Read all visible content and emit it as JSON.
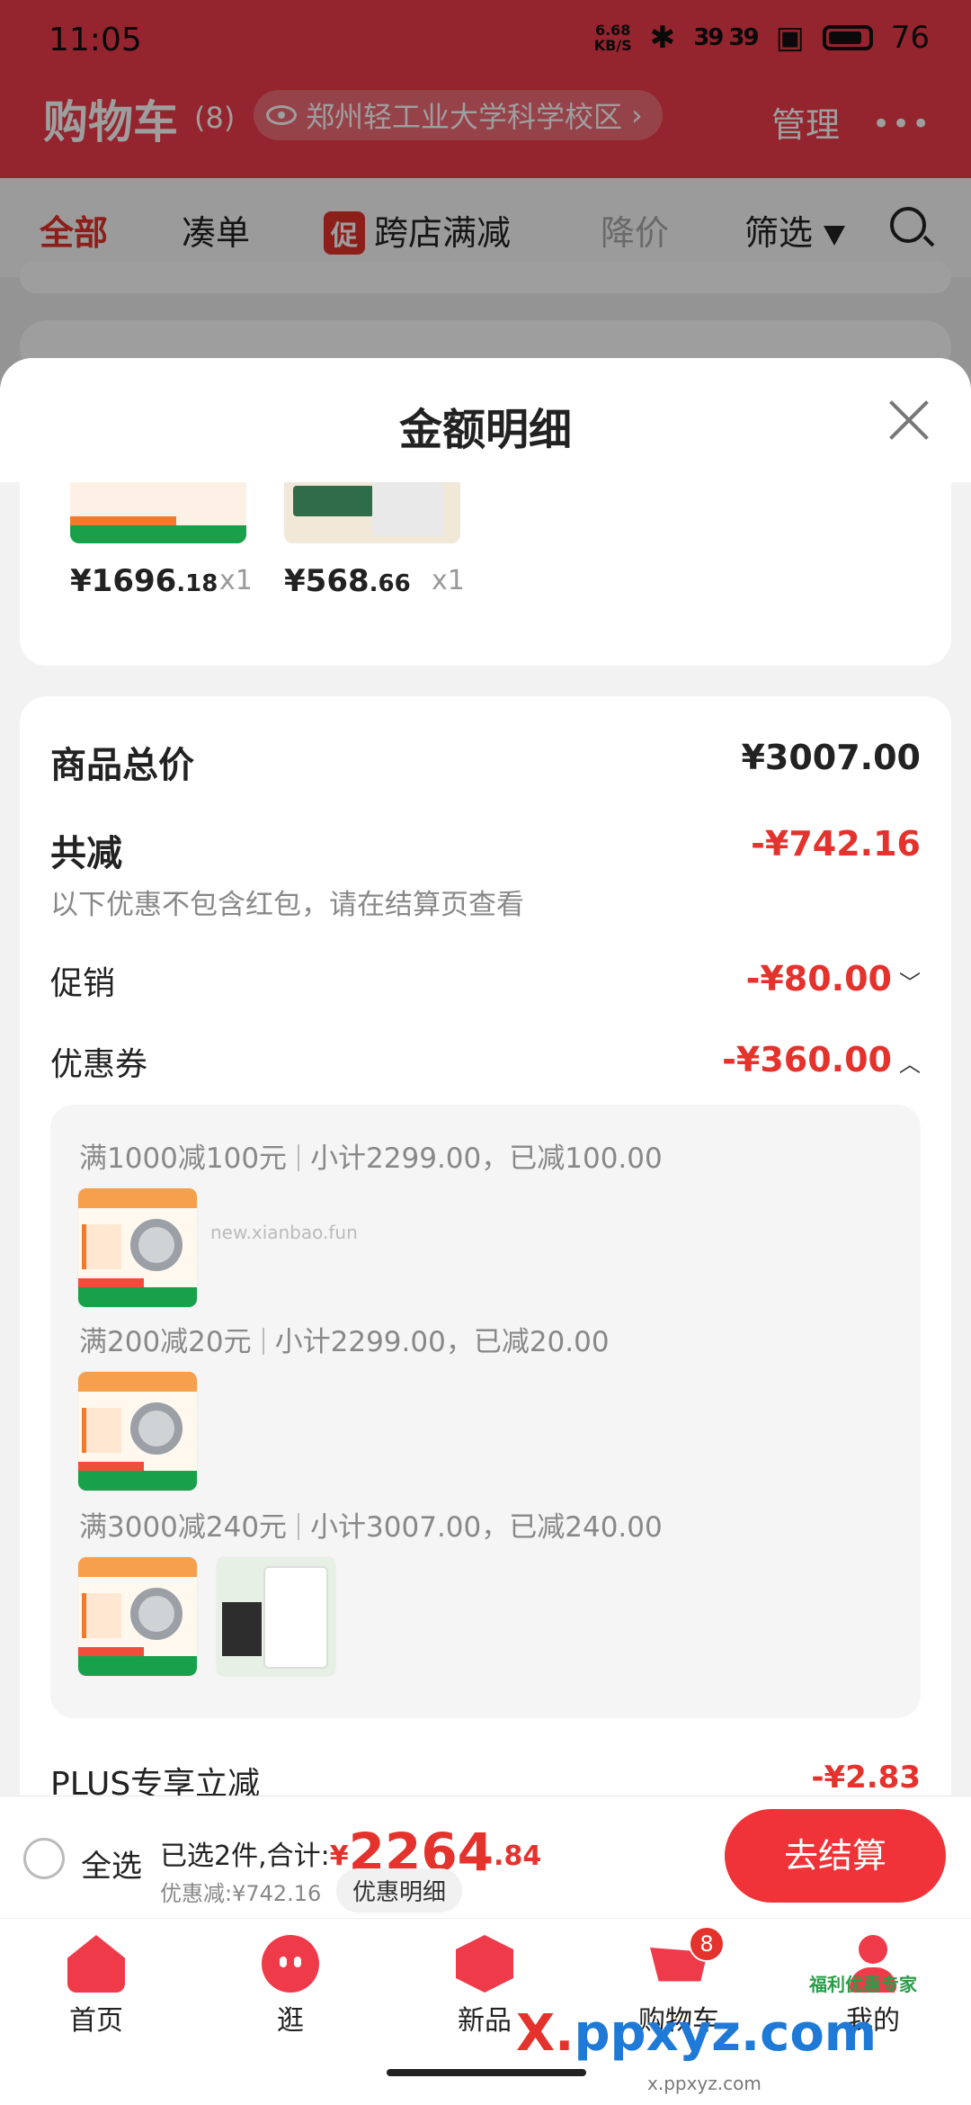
{
  "status_bar": {
    "time": "11:05",
    "net_speed_top": "6.68",
    "net_speed_bottom": "KB/S",
    "signal": "39 39",
    "battery": "76"
  },
  "header": {
    "title": "购物车",
    "count": "(8)",
    "location": "郑州轻工业大学科学校区",
    "manage": "管理"
  },
  "filter_tabs": {
    "all": "全部",
    "bundle": "凑单",
    "promo_badge": "促",
    "cross_store": "跨店满减",
    "price_drop": "降价",
    "filter": "筛选"
  },
  "sheet": {
    "title": "金额明细",
    "products": [
      {
        "price_int": "¥1696",
        "price_dec": ".18",
        "qty": "x1"
      },
      {
        "price_int": "¥568",
        "price_dec": ".66",
        "qty": "x1"
      }
    ],
    "total_label": "商品总价",
    "total_value": "¥3007.00",
    "discount_label": "共减",
    "discount_value": "-¥742.16",
    "discount_note": "以下优惠不包含红包，请在结算页查看",
    "promo_label": "促销",
    "promo_value": "-¥80.00",
    "coupon_label": "优惠券",
    "coupon_value": "-¥360.00",
    "coupons": [
      {
        "rule": "满1000减100元",
        "detail": "小计2299.00，已减100.00"
      },
      {
        "rule": "满200减20元",
        "detail": "小计2299.00，已减20.00"
      },
      {
        "rule": "满3000减240元",
        "detail": "小计3007.00，已减240.00"
      }
    ],
    "watermark": "new.xianbao.fun",
    "plus_label": "PLUS专享立减",
    "plus_value": "-¥2.83"
  },
  "checkout": {
    "select_all": "全选",
    "selected_text": "已选2件,合计:",
    "currency": "¥",
    "total_int": "2264",
    "total_dec": ".84",
    "discount_text": "优惠减:¥742.16",
    "detail_button": "优惠明细",
    "checkout_button": "去结算"
  },
  "bottom_nav": [
    {
      "label": "首页"
    },
    {
      "label": "逛"
    },
    {
      "label": "新品"
    },
    {
      "label": "购物车",
      "badge": "8"
    },
    {
      "label": "我的"
    }
  ],
  "watermark_site": {
    "logo_x": "X.",
    "logo_rest": "ppxyz.com",
    "sub": "x.ppxyz.com",
    "badge": "福利优惠专家"
  },
  "colors": {
    "accent_red": "#e4322c",
    "header_red": "#ef3a4a",
    "checkout_button": "#ef3338"
  }
}
